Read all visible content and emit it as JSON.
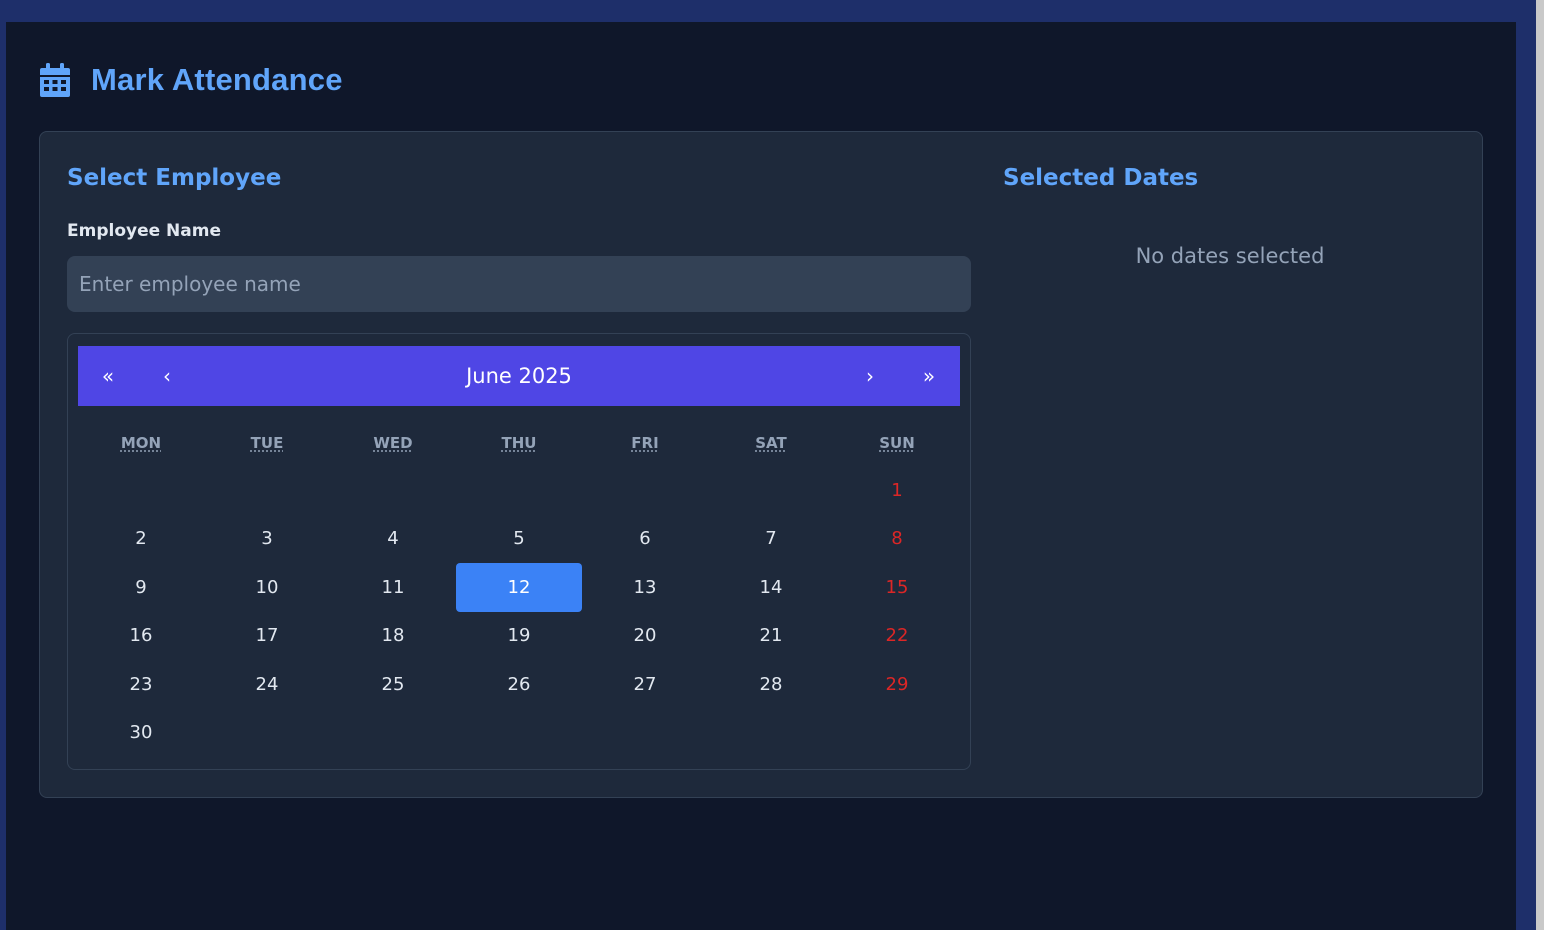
{
  "page": {
    "title": "Mark Attendance",
    "icon": "calendar-icon"
  },
  "employee_section": {
    "title": "Select Employee",
    "field_label": "Employee Name",
    "input_placeholder": "Enter employee name",
    "input_value": ""
  },
  "calendar": {
    "month_label": "June 2025",
    "nav": {
      "prev_year": "«",
      "prev_month": "‹",
      "next_month": "›",
      "next_year": "»"
    },
    "weekdays": [
      "MON",
      "TUE",
      "WED",
      "THU",
      "FRI",
      "SAT",
      "SUN"
    ],
    "first_day_column": 6,
    "days_in_month": 30,
    "highlighted_day": 12
  },
  "selected_dates_section": {
    "title": "Selected Dates",
    "empty_message": "No dates selected"
  },
  "colors": {
    "accent": "#60a5fa",
    "nav_bar": "#4f46e5",
    "highlight": "#3b82f6",
    "weekend": "#dc2626"
  }
}
